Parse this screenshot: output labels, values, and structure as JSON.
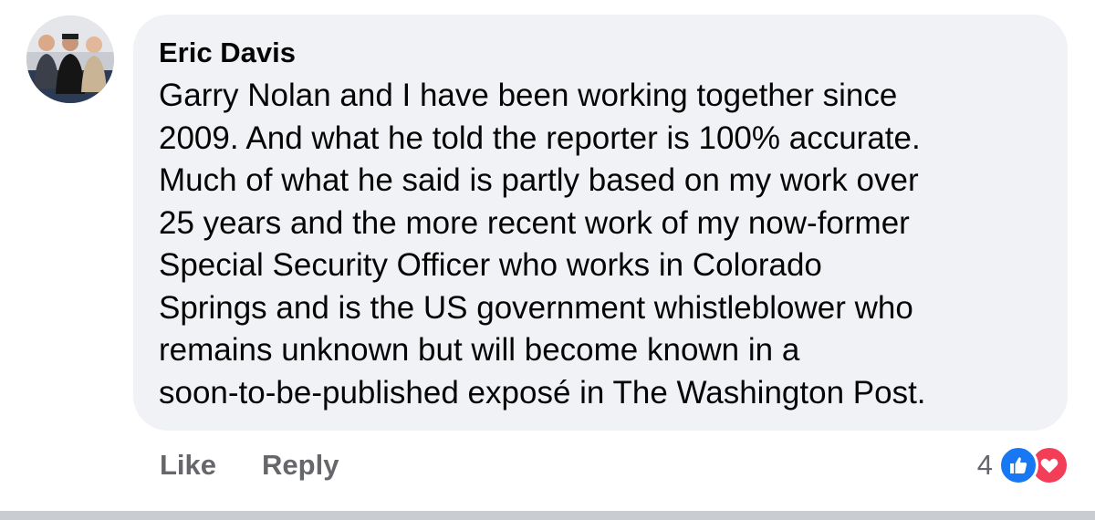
{
  "comment": {
    "author": "Eric Davis",
    "text_lines": [
      "Garry Nolan and I have been working together since",
      "2009. And what he told the reporter is 100% accurate.",
      "Much of what he said is partly based on my work over",
      "25 years and the more recent work of my now-former",
      "Special Security Officer who works in Colorado",
      "Springs and is the US government whistleblower who",
      "remains unknown but will become known in a",
      "soon-to-be-published exposé in The Washington Post."
    ],
    "actions": {
      "like_label": "Like",
      "reply_label": "Reply"
    },
    "reactions": {
      "count": "4",
      "icons": [
        "thumbs-up-icon",
        "heart-icon"
      ]
    }
  },
  "colors": {
    "bubble_bg": "#f0f2f5",
    "text": "#050505",
    "muted": "#65676b",
    "like_blue": "#1877f2",
    "love_red": "#f33e58"
  }
}
